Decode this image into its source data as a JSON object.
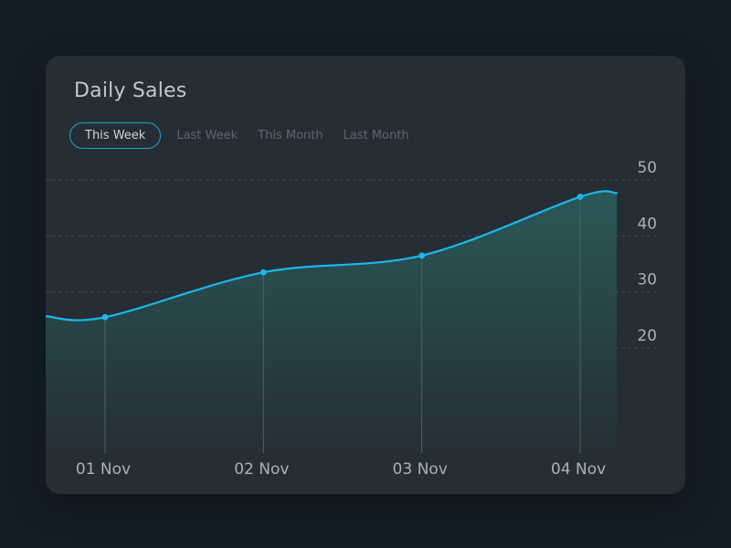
{
  "card": {
    "title": "Daily Sales"
  },
  "tabs": [
    {
      "label": "This Week",
      "active": true
    },
    {
      "label": "Last Week",
      "active": false
    },
    {
      "label": "This Month",
      "active": false
    },
    {
      "label": "Last Month",
      "active": false
    }
  ],
  "colors": {
    "background": "#141e27",
    "card": "#272d35",
    "line": "#19b8ea",
    "accent": "#1ba7c7",
    "area_top": "#2a5858",
    "area_bottom": "#252f36",
    "grid": "#3c454e",
    "tick_text": "#aab1b9"
  },
  "chart_data": {
    "type": "area",
    "title": "Daily Sales",
    "xlabel": "",
    "ylabel": "",
    "categories": [
      "01 Nov",
      "02 Nov",
      "03 Nov",
      "04 Nov"
    ],
    "values": [
      25.5,
      33.5,
      36.5,
      47
    ],
    "y_ticks": [
      20,
      30,
      40,
      50
    ],
    "ylim": [
      20,
      50
    ],
    "grid": true,
    "y_axis_position": "right",
    "markers": true,
    "smooth": true
  }
}
